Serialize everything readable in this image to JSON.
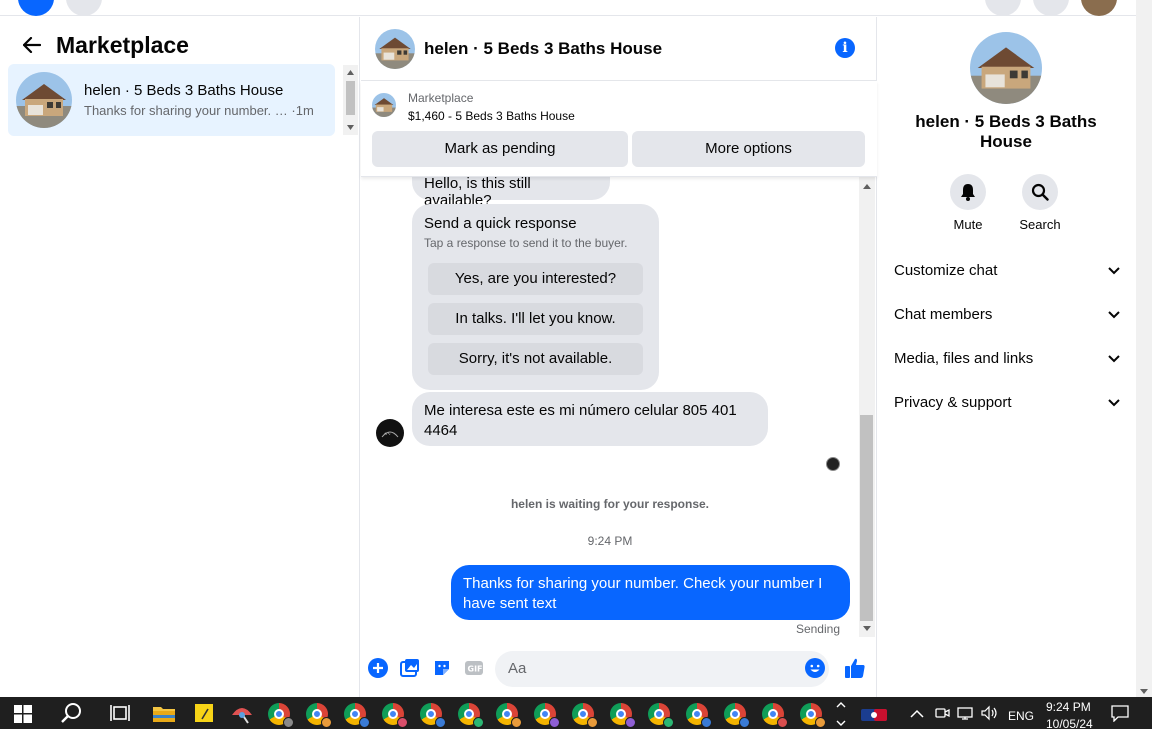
{
  "left_panel": {
    "title": "Marketplace",
    "conversation": {
      "name": "helen · 5 Beds 3 Baths House",
      "preview": "Thanks for sharing your number. …",
      "time": "·1m"
    }
  },
  "chat": {
    "header_name": "helen · 5 Beds 3 Baths House",
    "listing": {
      "source": "Marketplace",
      "price_title": "$1,460 - 5 Beds 3 Baths House",
      "mark_pending": "Mark as pending",
      "more_options": "More options"
    },
    "messages": {
      "first": "Hello, is this still available?",
      "quick_response_title": "Send a quick response",
      "quick_response_hint": "Tap a response to send it to the buyer.",
      "quick_responses": [
        "Yes, are you interested?",
        "In talks. I'll let you know.",
        "Sorry, it's not available."
      ],
      "buyer_message": "Me interesa  este  es mi número celular  805 401 4464",
      "waiting": "helen is waiting for your response.",
      "timestamp": "9:24 PM",
      "sent_message": "Thanks for sharing your number.  Check your number I have sent text",
      "sent_status": "Sending"
    },
    "composer_placeholder": "Aa",
    "colors": {
      "accent": "#0866ff",
      "bubble_in": "#e4e6eb"
    }
  },
  "details": {
    "name": "helen · 5 Beds 3 Baths House",
    "actions": [
      "Mute",
      "Search"
    ],
    "sections": [
      "Customize chat",
      "Chat members",
      "Media, files and links",
      "Privacy & support"
    ]
  },
  "taskbar": {
    "language": "ENG",
    "time": "9:24 PM",
    "date": "10/05/24"
  }
}
